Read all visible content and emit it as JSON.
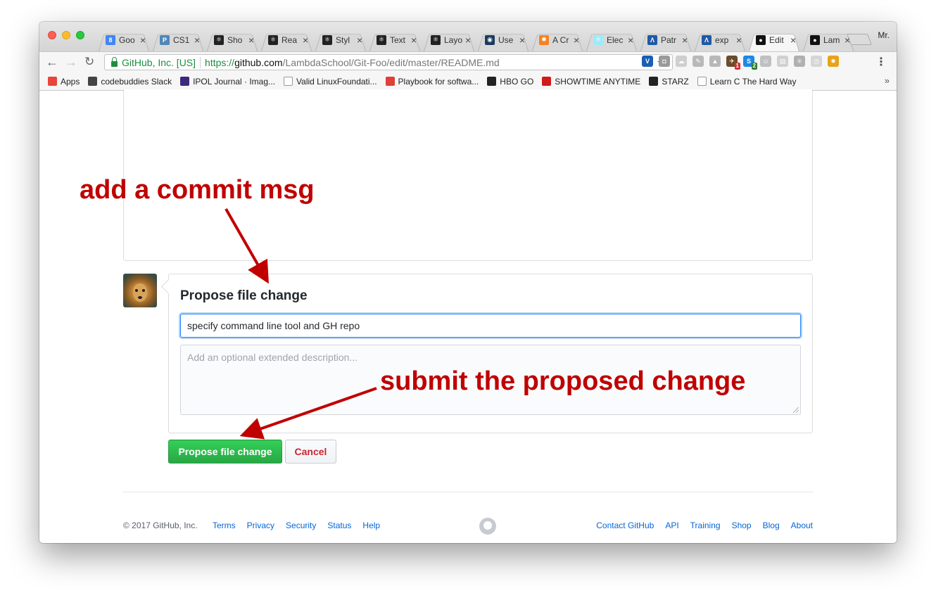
{
  "browser": {
    "profile": "Mr.",
    "tabs": [
      {
        "title": "Goo",
        "icon": "google-docs-icon",
        "color": "#4285f4",
        "glyph": "8"
      },
      {
        "title": "CS1",
        "icon": "p-icon",
        "color": "#4f87b6",
        "glyph": "P"
      },
      {
        "title": "Sho",
        "icon": "react-icon",
        "color": "#222222",
        "glyph": "⚛"
      },
      {
        "title": "Rea",
        "icon": "react-icon",
        "color": "#222222",
        "glyph": "⚛"
      },
      {
        "title": "Styl",
        "icon": "react-icon",
        "color": "#222222",
        "glyph": "⚛"
      },
      {
        "title": "Text",
        "icon": "react-icon",
        "color": "#222222",
        "glyph": "⚛"
      },
      {
        "title": "Layo",
        "icon": "react-icon",
        "color": "#222222",
        "glyph": "⚛"
      },
      {
        "title": "Use",
        "icon": "circle-icon",
        "color": "#1d3a5c",
        "glyph": "◉"
      },
      {
        "title": "A Cr",
        "icon": "asterisk-icon",
        "color": "#f58220",
        "glyph": "✱"
      },
      {
        "title": "Elec",
        "icon": "electron-icon",
        "color": "#9feaf9",
        "glyph": "⚛"
      },
      {
        "title": "Patr",
        "icon": "lambda-icon",
        "color": "#1f5aa6",
        "glyph": "Λ"
      },
      {
        "title": "exp",
        "icon": "lambda-icon",
        "color": "#1f5aa6",
        "glyph": "Λ"
      },
      {
        "title": "Edit",
        "icon": "github-icon",
        "color": "#111111",
        "glyph": "●",
        "active": true
      },
      {
        "title": "Lam",
        "icon": "github-icon",
        "color": "#111111",
        "glyph": "●"
      }
    ],
    "address": {
      "secure_label": "GitHub, Inc. [US]",
      "protocol": "https://",
      "host": "github.com",
      "path": "/LambdaSchool/Git-Foo/edit/master/README.md"
    },
    "bookmarks": [
      {
        "label": "Apps",
        "icon": "apps-grid-icon",
        "color": "#e8453c"
      },
      {
        "label": "codebuddies Slack",
        "icon": "hash-icon",
        "color": "#444444"
      },
      {
        "label": "IPOL Journal · Imag...",
        "icon": "hexagon-icon",
        "color": "#3b2a7a"
      },
      {
        "label": "Valid LinuxFoundati...",
        "icon": "page-icon",
        "color": "#ffffff"
      },
      {
        "label": "Playbook for softwa...",
        "icon": "robot-icon",
        "color": "#e0403a"
      },
      {
        "label": "HBO GO",
        "icon": "circle-icon",
        "color": "#222222"
      },
      {
        "label": "SHOWTIME ANYTIME",
        "icon": "sho-icon",
        "color": "#d11a1a"
      },
      {
        "label": "STARZ",
        "icon": "s-icon",
        "color": "#222222"
      },
      {
        "label": "Learn C The Hard Way",
        "icon": "page-icon",
        "color": "#ffffff"
      }
    ]
  },
  "commit": {
    "title": "Propose file change",
    "message_value": "specify command line tool and GH repo",
    "description_placeholder": "Add an optional extended description...",
    "propose_label": "Propose file change",
    "cancel_label": "Cancel"
  },
  "footer": {
    "copyright": "© 2017 GitHub, Inc.",
    "left_links": [
      "Terms",
      "Privacy",
      "Security",
      "Status",
      "Help"
    ],
    "right_links": [
      "Contact GitHub",
      "API",
      "Training",
      "Shop",
      "Blog",
      "About"
    ]
  },
  "annotations": {
    "commit_msg": "add a commit msg",
    "submit": "submit the proposed change"
  },
  "colors": {
    "annotation": "#c00000",
    "primary_button": "#28a745",
    "cancel_text": "#cb2431",
    "link": "#0366d6"
  }
}
